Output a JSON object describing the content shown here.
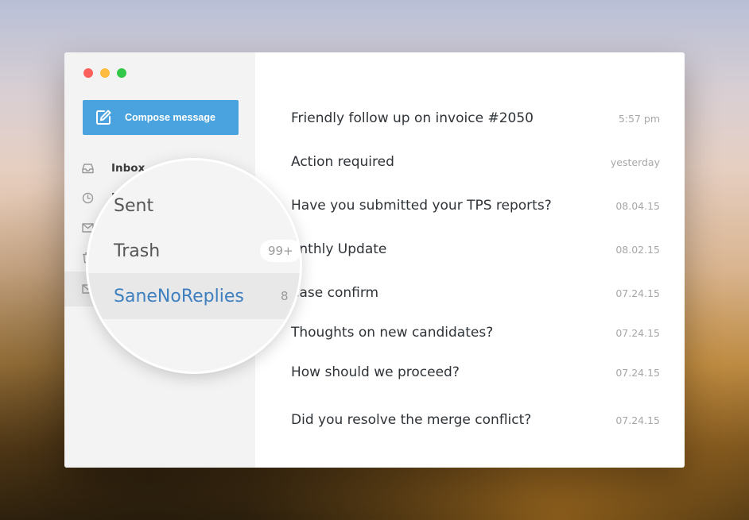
{
  "window": {
    "traffic_lights": [
      "#fc605c",
      "#fdbc40",
      "#34c84a"
    ]
  },
  "sidebar": {
    "compose": {
      "label": "Compose message",
      "icon": "pencil-square-icon",
      "color": "#4aa3df"
    },
    "items": [
      {
        "label": "Inbox",
        "icon": "inbox-tray-icon"
      },
      {
        "label": "D",
        "icon": "clock-icon"
      },
      {
        "label": "",
        "icon": "envelope-icon"
      },
      {
        "label": "",
        "icon": "trash-icon"
      },
      {
        "label": "",
        "icon": "envelope-icon"
      }
    ]
  },
  "magnifier": {
    "items": [
      {
        "label": "Sent",
        "badge": ""
      },
      {
        "label": "Trash",
        "badge": "99+"
      },
      {
        "label": "SaneNoReplies",
        "count": "8",
        "selected": true
      }
    ]
  },
  "messages": [
    {
      "subject": "Friendly follow up on invoice #2050",
      "date": "5:57 pm"
    },
    {
      "subject": "Action required",
      "date": "yesterday"
    },
    {
      "subject": "Have you submitted your TPS reports?",
      "date": "08.04.15"
    },
    {
      "subject": "onthly Update",
      "date": "08.02.15"
    },
    {
      "subject": "ease confirm",
      "date": "07.24.15"
    },
    {
      "subject": "Thoughts on new candidates?",
      "date": "07.24.15"
    },
    {
      "subject": "How should we proceed?",
      "date": "07.24.15"
    },
    {
      "subject": "Did you resolve the merge conflict?",
      "date": "07.24.15"
    }
  ]
}
